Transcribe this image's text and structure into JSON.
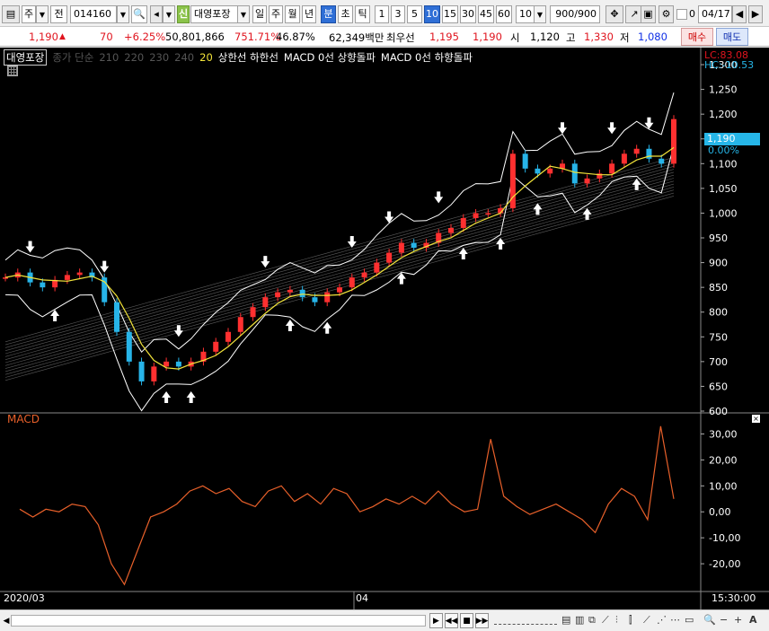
{
  "toolbar": {
    "market": "주",
    "prev": "전",
    "code": "014160",
    "badge": "신",
    "stock_name": "대영포장",
    "periods": [
      "일",
      "주",
      "월",
      "년",
      "분",
      "초",
      "틱"
    ],
    "selected_period": "분",
    "intervals": [
      "1",
      "3",
      "5",
      "10",
      "15",
      "30",
      "45",
      "60"
    ],
    "selected_interval": "10",
    "interval_value": "10",
    "count": "900",
    "count_total": "/900",
    "checkbox_label": "0",
    "date": "04/17"
  },
  "info": {
    "price": "1,190",
    "arrow": "▲",
    "change": "70",
    "change_pct": "+6.25%",
    "volume": "50,801,866",
    "volume_ratio": "751.71%",
    "turnover": "46.87%",
    "amount": "62,349백만",
    "best_label": "최우선",
    "ask": "1,195",
    "bid": "1,190",
    "open_label": "시",
    "open": "1,120",
    "high_label": "고",
    "high": "1,330",
    "low_label": "저",
    "low": "1,080",
    "buy": "매수",
    "sell": "매도"
  },
  "legend": {
    "name": "대영포장",
    "ma_label": "종가 단순",
    "ma_periods": [
      "210",
      "220",
      "230",
      "240"
    ],
    "ma_active": "20",
    "bands": "상한선  하한선",
    "macd_up": "MACD 0선 상향돌파",
    "macd_down": "MACD 0선 하향돌파"
  },
  "overlay": {
    "lc": "LC:83.08",
    "hc": "HC:-10.53",
    "price_tag": "1,190",
    "pct_tag": "0.00%"
  },
  "price_axis": [
    "1,300",
    "1,250",
    "1,200",
    "1,150",
    "1,100",
    "1,050",
    "1,000",
    "950",
    "900",
    "850",
    "800",
    "750",
    "700",
    "650",
    "600"
  ],
  "macd": {
    "title": "MACD",
    "axis": [
      "30,00",
      "20,00",
      "10,00",
      "0,00",
      "-10,00",
      "-20,00"
    ]
  },
  "dates": {
    "start": "2020/03",
    "mid": "04",
    "time": "15:30:00"
  },
  "colors": {
    "up": "#ff3030",
    "down": "#27b4e8",
    "ma": "#f3e43a",
    "band": "#ffffff",
    "macd": "#e8602a",
    "price_tag": "#26b6e8"
  },
  "chart_data": [
    {
      "type": "candlestick",
      "title": "대영포장",
      "ylim": [
        600,
        1320
      ],
      "close_series": [
        870,
        880,
        860,
        850,
        865,
        875,
        880,
        870,
        820,
        760,
        700,
        660,
        690,
        700,
        690,
        700,
        720,
        740,
        760,
        790,
        810,
        830,
        840,
        845,
        830,
        820,
        840,
        850,
        870,
        880,
        900,
        920,
        940,
        930,
        940,
        960,
        970,
        990,
        1000,
        1000,
        1010,
        1120,
        1090,
        1080,
        1090,
        1100,
        1060,
        1070,
        1080,
        1100,
        1120,
        1130,
        1110,
        1100,
        1190
      ]
    },
    {
      "type": "line",
      "title": "MACD",
      "ylim": [
        -30,
        35
      ],
      "values": [
        1,
        -2,
        1,
        0,
        3,
        2,
        -5,
        -20,
        -28,
        -15,
        -2,
        0,
        3,
        8,
        10,
        7,
        9,
        4,
        2,
        8,
        10,
        4,
        7,
        3,
        9,
        7,
        0,
        2,
        5,
        3,
        6,
        3,
        8,
        3,
        0,
        1,
        28,
        6,
        2,
        -1,
        1,
        3,
        0,
        -3,
        -8,
        3,
        9,
        6,
        -3,
        33,
        5
      ]
    }
  ]
}
